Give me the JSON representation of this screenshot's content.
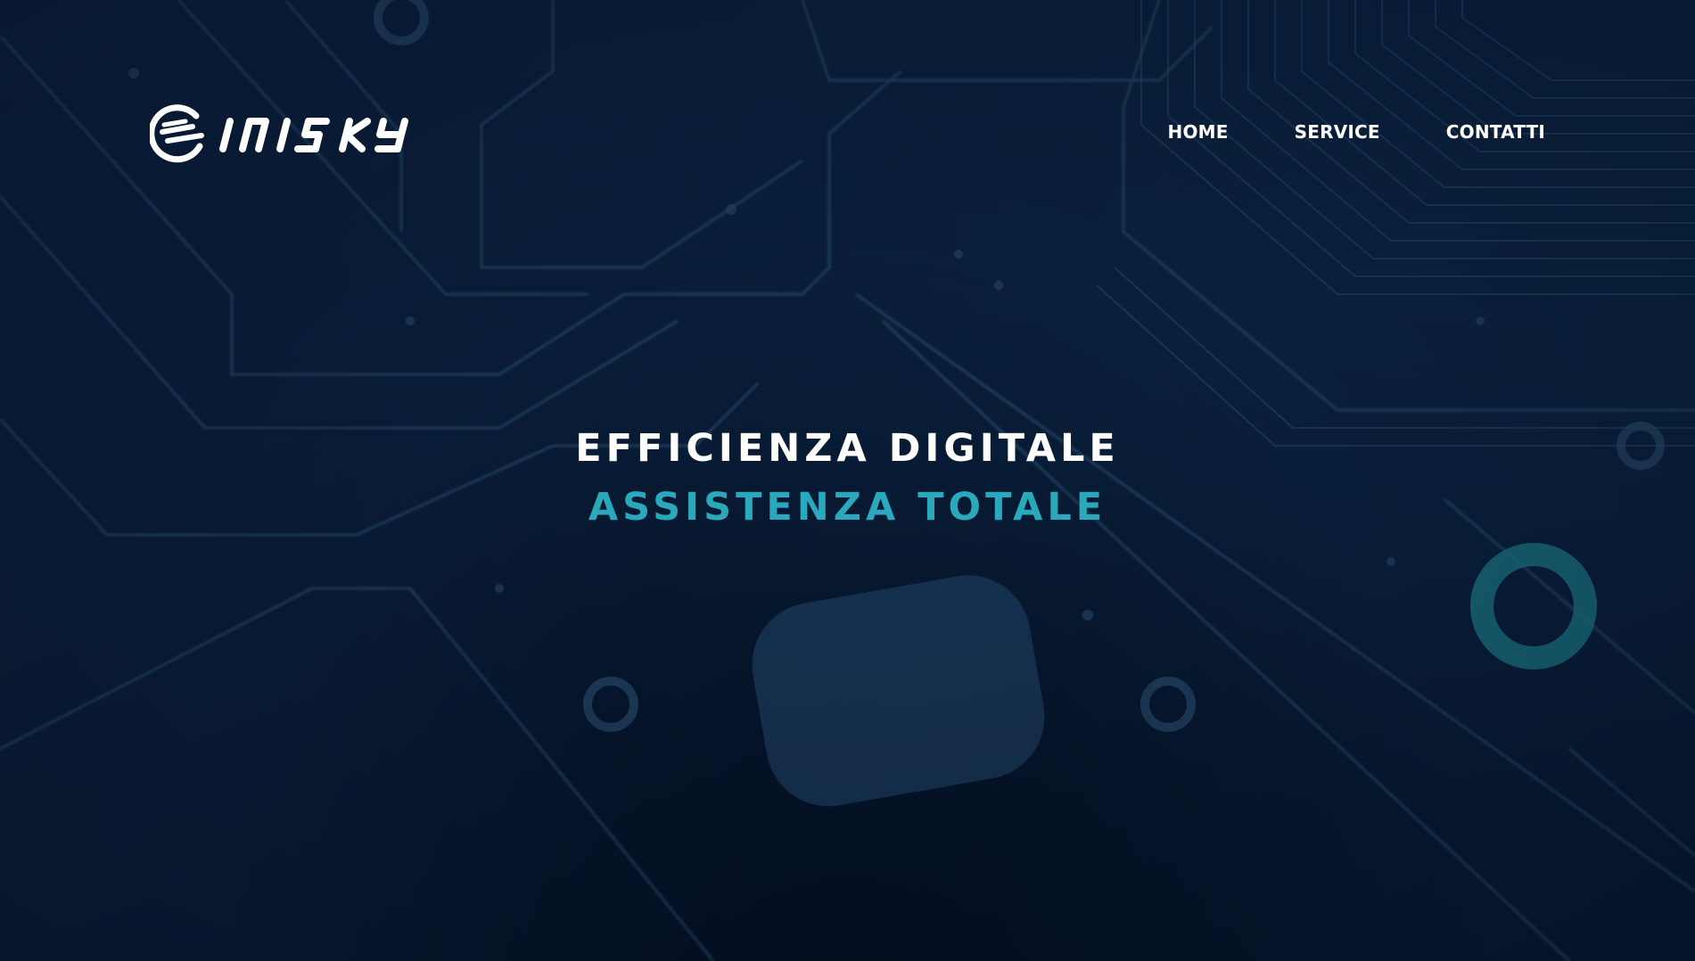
{
  "brand": {
    "logo_text": "INISKY",
    "logo_icon": "swirl-s-icon"
  },
  "nav": {
    "items": [
      {
        "label": "HOME"
      },
      {
        "label": "SERVICE"
      },
      {
        "label": "CONTATTI"
      }
    ]
  },
  "hero": {
    "line1": "EFFICIENZA DIGITALE",
    "line2": "ASSISTENZA TOTALE"
  },
  "colors": {
    "background": "#0a1f3c",
    "accent": "#2aa9bd",
    "text": "#ffffff",
    "circuit": "#3a6a90"
  }
}
